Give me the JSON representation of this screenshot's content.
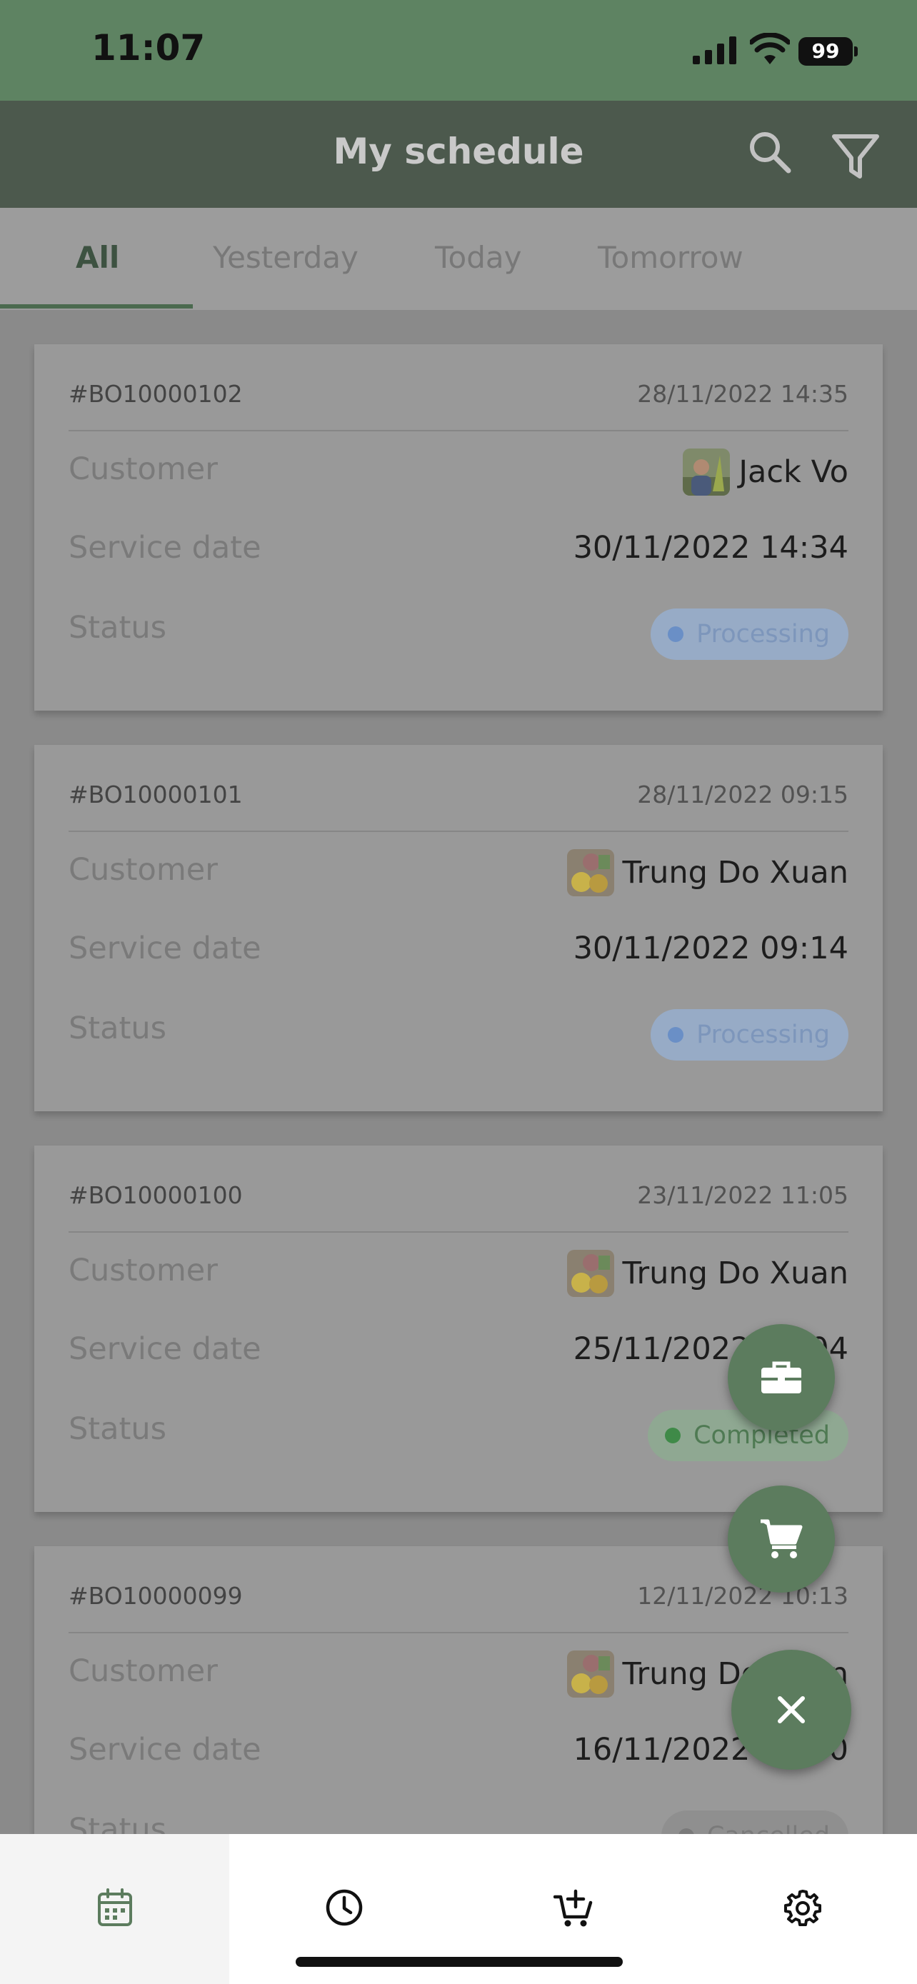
{
  "status_bar": {
    "time": "11:07",
    "battery": "99"
  },
  "header": {
    "title": "My schedule",
    "icons": [
      "search-icon",
      "filter-icon"
    ]
  },
  "tabs": [
    {
      "label": "All",
      "active": true
    },
    {
      "label": "Yesterday",
      "active": false
    },
    {
      "label": "Today",
      "active": false
    },
    {
      "label": "Tomorrow",
      "active": false
    }
  ],
  "field_labels": {
    "customer": "Customer",
    "service_date": "Service date",
    "status": "Status"
  },
  "bookings": [
    {
      "code": "#BO10000102",
      "created": "28/11/2022 14:35",
      "customer": "Jack Vo",
      "service_date": "30/11/2022 14:34",
      "status": "Processing"
    },
    {
      "code": "#BO10000101",
      "created": "28/11/2022 09:15",
      "customer": "Trung Do Xuan",
      "service_date": "30/11/2022 09:14",
      "status": "Processing"
    },
    {
      "code": "#BO10000100",
      "created": "23/11/2022 11:05",
      "customer": "Trung Do Xuan",
      "service_date": "25/11/2022 11:04",
      "status": "Completed"
    },
    {
      "code": "#BO10000099",
      "created": "12/11/2022 10:13",
      "customer": "Trung Do Xuan",
      "service_date": "16/11/2022 10:00",
      "status": "Cancelled"
    }
  ],
  "status_colors": {
    "Processing": {
      "bg": "#97abc6",
      "dot": "#6a8fc6",
      "text": "#7d96bb"
    },
    "Completed": {
      "bg": "#8fa892",
      "dot": "#3f8a48",
      "text": "#4f7a53"
    },
    "Cancelled": {
      "bg": "#8f8f8f",
      "dot": "#7a7a7a",
      "text": "#7a7a7a"
    }
  },
  "fab_actions": [
    "toolbox-icon",
    "cart-icon",
    "close-icon"
  ],
  "bottom_tabs": [
    {
      "icon": "calendar-icon",
      "active": true
    },
    {
      "icon": "clock-icon",
      "active": false
    },
    {
      "icon": "cart-add-icon",
      "active": false
    },
    {
      "icon": "gear-icon",
      "active": false
    }
  ],
  "colors": {
    "accent": "#5c7c5e",
    "header": "#4c594d",
    "status_bar": "#5e8362"
  }
}
